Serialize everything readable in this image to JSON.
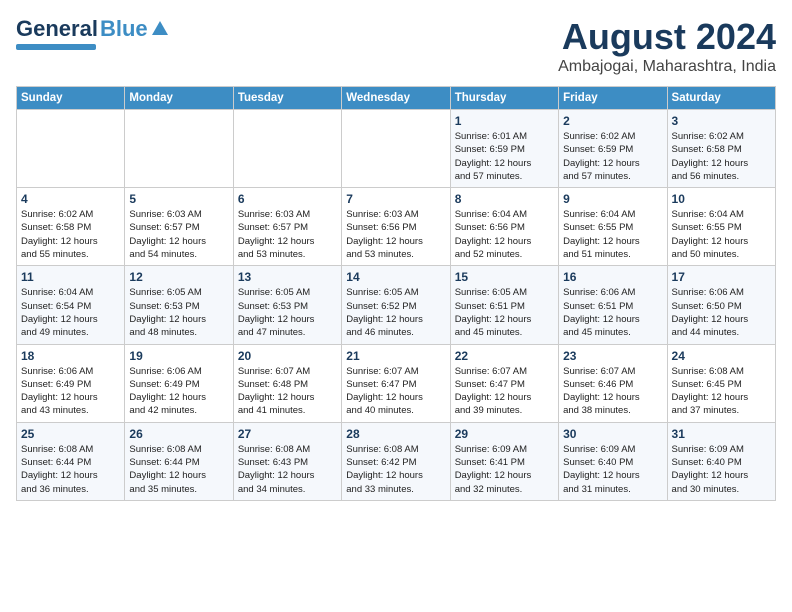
{
  "header": {
    "logo_general": "General",
    "logo_blue": "Blue",
    "month_title": "August 2024",
    "location": "Ambajogai, Maharashtra, India"
  },
  "weekdays": [
    "Sunday",
    "Monday",
    "Tuesday",
    "Wednesday",
    "Thursday",
    "Friday",
    "Saturday"
  ],
  "weeks": [
    [
      {
        "day": "",
        "info": ""
      },
      {
        "day": "",
        "info": ""
      },
      {
        "day": "",
        "info": ""
      },
      {
        "day": "",
        "info": ""
      },
      {
        "day": "1",
        "info": "Sunrise: 6:01 AM\nSunset: 6:59 PM\nDaylight: 12 hours\nand 57 minutes."
      },
      {
        "day": "2",
        "info": "Sunrise: 6:02 AM\nSunset: 6:59 PM\nDaylight: 12 hours\nand 57 minutes."
      },
      {
        "day": "3",
        "info": "Sunrise: 6:02 AM\nSunset: 6:58 PM\nDaylight: 12 hours\nand 56 minutes."
      }
    ],
    [
      {
        "day": "4",
        "info": "Sunrise: 6:02 AM\nSunset: 6:58 PM\nDaylight: 12 hours\nand 55 minutes."
      },
      {
        "day": "5",
        "info": "Sunrise: 6:03 AM\nSunset: 6:57 PM\nDaylight: 12 hours\nand 54 minutes."
      },
      {
        "day": "6",
        "info": "Sunrise: 6:03 AM\nSunset: 6:57 PM\nDaylight: 12 hours\nand 53 minutes."
      },
      {
        "day": "7",
        "info": "Sunrise: 6:03 AM\nSunset: 6:56 PM\nDaylight: 12 hours\nand 53 minutes."
      },
      {
        "day": "8",
        "info": "Sunrise: 6:04 AM\nSunset: 6:56 PM\nDaylight: 12 hours\nand 52 minutes."
      },
      {
        "day": "9",
        "info": "Sunrise: 6:04 AM\nSunset: 6:55 PM\nDaylight: 12 hours\nand 51 minutes."
      },
      {
        "day": "10",
        "info": "Sunrise: 6:04 AM\nSunset: 6:55 PM\nDaylight: 12 hours\nand 50 minutes."
      }
    ],
    [
      {
        "day": "11",
        "info": "Sunrise: 6:04 AM\nSunset: 6:54 PM\nDaylight: 12 hours\nand 49 minutes."
      },
      {
        "day": "12",
        "info": "Sunrise: 6:05 AM\nSunset: 6:53 PM\nDaylight: 12 hours\nand 48 minutes."
      },
      {
        "day": "13",
        "info": "Sunrise: 6:05 AM\nSunset: 6:53 PM\nDaylight: 12 hours\nand 47 minutes."
      },
      {
        "day": "14",
        "info": "Sunrise: 6:05 AM\nSunset: 6:52 PM\nDaylight: 12 hours\nand 46 minutes."
      },
      {
        "day": "15",
        "info": "Sunrise: 6:05 AM\nSunset: 6:51 PM\nDaylight: 12 hours\nand 45 minutes."
      },
      {
        "day": "16",
        "info": "Sunrise: 6:06 AM\nSunset: 6:51 PM\nDaylight: 12 hours\nand 45 minutes."
      },
      {
        "day": "17",
        "info": "Sunrise: 6:06 AM\nSunset: 6:50 PM\nDaylight: 12 hours\nand 44 minutes."
      }
    ],
    [
      {
        "day": "18",
        "info": "Sunrise: 6:06 AM\nSunset: 6:49 PM\nDaylight: 12 hours\nand 43 minutes."
      },
      {
        "day": "19",
        "info": "Sunrise: 6:06 AM\nSunset: 6:49 PM\nDaylight: 12 hours\nand 42 minutes."
      },
      {
        "day": "20",
        "info": "Sunrise: 6:07 AM\nSunset: 6:48 PM\nDaylight: 12 hours\nand 41 minutes."
      },
      {
        "day": "21",
        "info": "Sunrise: 6:07 AM\nSunset: 6:47 PM\nDaylight: 12 hours\nand 40 minutes."
      },
      {
        "day": "22",
        "info": "Sunrise: 6:07 AM\nSunset: 6:47 PM\nDaylight: 12 hours\nand 39 minutes."
      },
      {
        "day": "23",
        "info": "Sunrise: 6:07 AM\nSunset: 6:46 PM\nDaylight: 12 hours\nand 38 minutes."
      },
      {
        "day": "24",
        "info": "Sunrise: 6:08 AM\nSunset: 6:45 PM\nDaylight: 12 hours\nand 37 minutes."
      }
    ],
    [
      {
        "day": "25",
        "info": "Sunrise: 6:08 AM\nSunset: 6:44 PM\nDaylight: 12 hours\nand 36 minutes."
      },
      {
        "day": "26",
        "info": "Sunrise: 6:08 AM\nSunset: 6:44 PM\nDaylight: 12 hours\nand 35 minutes."
      },
      {
        "day": "27",
        "info": "Sunrise: 6:08 AM\nSunset: 6:43 PM\nDaylight: 12 hours\nand 34 minutes."
      },
      {
        "day": "28",
        "info": "Sunrise: 6:08 AM\nSunset: 6:42 PM\nDaylight: 12 hours\nand 33 minutes."
      },
      {
        "day": "29",
        "info": "Sunrise: 6:09 AM\nSunset: 6:41 PM\nDaylight: 12 hours\nand 32 minutes."
      },
      {
        "day": "30",
        "info": "Sunrise: 6:09 AM\nSunset: 6:40 PM\nDaylight: 12 hours\nand 31 minutes."
      },
      {
        "day": "31",
        "info": "Sunrise: 6:09 AM\nSunset: 6:40 PM\nDaylight: 12 hours\nand 30 minutes."
      }
    ]
  ]
}
